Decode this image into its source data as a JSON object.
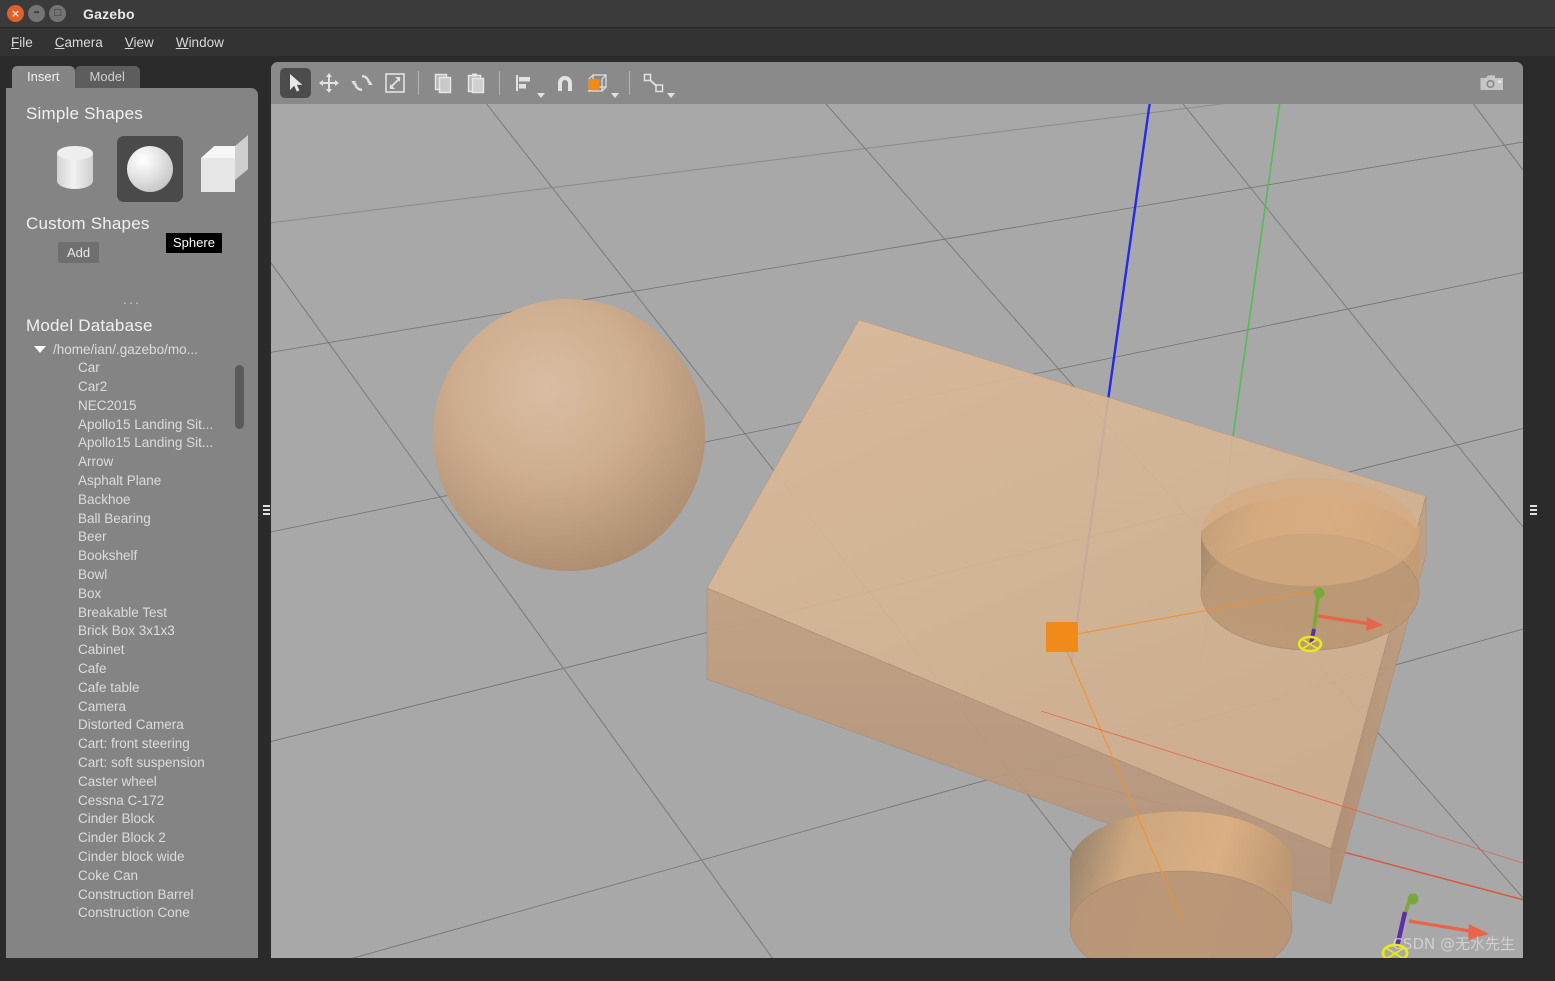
{
  "window": {
    "title": "Gazebo",
    "controls": [
      {
        "name": "close",
        "glyph": "×"
      },
      {
        "name": "minimize",
        "glyph": "–"
      },
      {
        "name": "maximize",
        "glyph": "□"
      }
    ]
  },
  "menu": {
    "items": [
      {
        "label": "File",
        "accel": "F"
      },
      {
        "label": "Camera",
        "accel": "C"
      },
      {
        "label": "View",
        "accel": "V"
      },
      {
        "label": "Window",
        "accel": "W"
      }
    ]
  },
  "left_panel": {
    "tabs": [
      {
        "label": "Insert",
        "active": true
      },
      {
        "label": "Model",
        "active": false
      }
    ],
    "simple_shapes": {
      "title": "Simple Shapes",
      "shapes": [
        {
          "label": "Cylinder",
          "icon": "cylinder-icon",
          "selected": false
        },
        {
          "label": "Sphere",
          "icon": "sphere-icon",
          "selected": true
        },
        {
          "label": "Box",
          "icon": "box-icon",
          "selected": false
        }
      ],
      "tooltip": "Sphere"
    },
    "custom_shapes": {
      "title": "Custom Shapes",
      "add_label": "Add"
    },
    "model_database": {
      "title": "Model Database",
      "root": "/home/ian/.gazebo/mo...",
      "items": [
        "Car",
        "Car2",
        "NEC2015",
        "Apollo15 Landing Sit...",
        "Apollo15 Landing Sit...",
        "Arrow",
        "Asphalt Plane",
        "Backhoe",
        "Ball Bearing",
        "Beer",
        "Bookshelf",
        "Bowl",
        "Box",
        "Breakable Test",
        "Brick Box 3x1x3",
        "Cabinet",
        "Cafe",
        "Cafe table",
        "Camera",
        "Distorted Camera",
        "Cart: front steering",
        "Cart: soft suspension",
        "Caster wheel",
        "Cessna C-172",
        "Cinder Block",
        "Cinder Block 2",
        "Cinder block wide",
        "Coke Can",
        "Construction Barrel",
        "Construction Cone"
      ]
    }
  },
  "toolbar": {
    "buttons": [
      {
        "name": "select-tool",
        "label": "Selection Mode",
        "selected": true
      },
      {
        "name": "translate-tool",
        "label": "Translation Mode",
        "selected": false
      },
      {
        "name": "rotate-tool",
        "label": "Rotation Mode",
        "selected": false
      },
      {
        "name": "scale-tool",
        "label": "Scale Mode",
        "selected": false
      },
      {
        "name": "copy-button",
        "label": "Copy",
        "selected": false
      },
      {
        "name": "paste-button",
        "label": "Paste",
        "selected": false
      },
      {
        "name": "align-tool",
        "label": "Align",
        "selected": false,
        "dropdown": true
      },
      {
        "name": "snap-tool",
        "label": "Snap",
        "selected": false
      },
      {
        "name": "material-tool",
        "label": "Material",
        "selected": false,
        "dropdown": true,
        "color": "#f08a18"
      },
      {
        "name": "joint-tool",
        "label": "Create Joint",
        "selected": false,
        "dropdown": true
      }
    ],
    "screenshot_label": "Screenshot"
  },
  "viewport": {
    "background_color": "#a8a8a8",
    "grid_color": "#6e6e6e",
    "axis_colors": {
      "x": "#e04a2a",
      "y": "#3fc23f",
      "z": "#1b1bf0"
    },
    "objects": [
      {
        "name": "sphere",
        "color": "#c8a98c"
      },
      {
        "name": "chassis-box",
        "color": "#d7b595"
      },
      {
        "name": "wheel-right",
        "color": "#cfa87e"
      },
      {
        "name": "wheel-left",
        "color": "#cfa87e"
      }
    ],
    "joint_marker_colors": {
      "axis_x": "#e8644a",
      "axis_z": "#5a2fa8",
      "axis_y": "#7aa83c",
      "ring": "#e8e81a"
    },
    "selection_marker_color": "#f08a18"
  },
  "watermark": {
    "text": "CSDN @无水先生"
  }
}
